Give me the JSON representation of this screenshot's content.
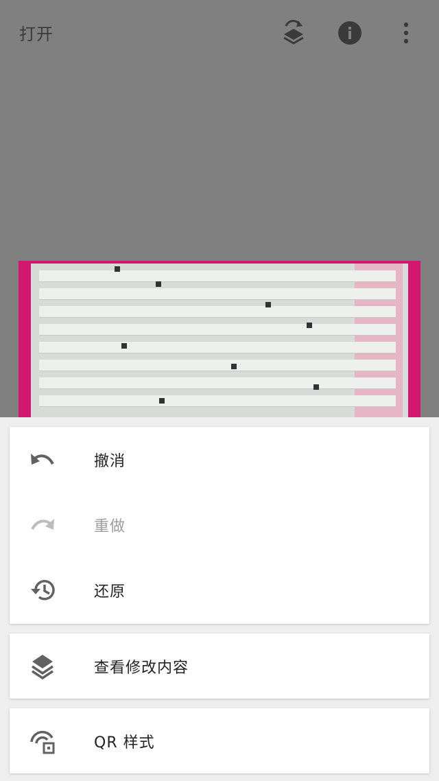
{
  "appbar": {
    "open_label": "打开",
    "icons": [
      "layers-rotate-icon",
      "info-icon",
      "more-vert-icon"
    ]
  },
  "menu": {
    "group1": [
      {
        "label": "撤消",
        "icon": "undo-icon",
        "enabled": true
      },
      {
        "label": "重做",
        "icon": "redo-icon",
        "enabled": false
      },
      {
        "label": "还原",
        "icon": "history-icon",
        "enabled": true
      }
    ],
    "group2": [
      {
        "label": "查看修改内容",
        "icon": "layers-icon",
        "enabled": true
      }
    ],
    "group3": [
      {
        "label": "QR 样式",
        "icon": "qr-style-icon",
        "enabled": true
      }
    ]
  },
  "colors": {
    "scrim_background": "#808080",
    "icon_gray": "#616161",
    "disabled_gray": "#bdbdbd",
    "photo_magenta": "#d2176f"
  }
}
